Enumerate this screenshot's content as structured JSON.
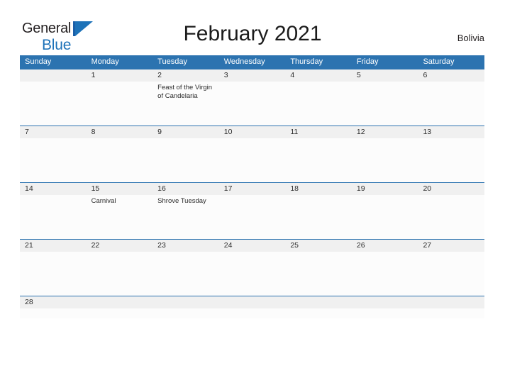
{
  "brand": {
    "word1": "General",
    "word2": "Blue",
    "mark": "triangle-logo"
  },
  "header": {
    "title": "February 2021",
    "region": "Bolivia"
  },
  "calendar": {
    "weekday_headers": [
      "Sunday",
      "Monday",
      "Tuesday",
      "Wednesday",
      "Thursday",
      "Friday",
      "Saturday"
    ],
    "colors": {
      "header_blue": "#2c73b0",
      "band_gray": "#f0f0f0",
      "divider_blue": "#2c73b0",
      "text_dark": "#2b2b2b",
      "brand_blue": "#1d72b8"
    },
    "weeks": [
      {
        "days": [
          {
            "number": "",
            "event": ""
          },
          {
            "number": "1",
            "event": ""
          },
          {
            "number": "2",
            "event": "Feast of the Virgin\nof Candelaria"
          },
          {
            "number": "3",
            "event": ""
          },
          {
            "number": "4",
            "event": ""
          },
          {
            "number": "5",
            "event": ""
          },
          {
            "number": "6",
            "event": ""
          }
        ]
      },
      {
        "days": [
          {
            "number": "7",
            "event": ""
          },
          {
            "number": "8",
            "event": ""
          },
          {
            "number": "9",
            "event": ""
          },
          {
            "number": "10",
            "event": ""
          },
          {
            "number": "11",
            "event": ""
          },
          {
            "number": "12",
            "event": ""
          },
          {
            "number": "13",
            "event": ""
          }
        ]
      },
      {
        "days": [
          {
            "number": "14",
            "event": ""
          },
          {
            "number": "15",
            "event": "Carnival"
          },
          {
            "number": "16",
            "event": "Shrove Tuesday"
          },
          {
            "number": "17",
            "event": ""
          },
          {
            "number": "18",
            "event": ""
          },
          {
            "number": "19",
            "event": ""
          },
          {
            "number": "20",
            "event": ""
          }
        ]
      },
      {
        "days": [
          {
            "number": "21",
            "event": ""
          },
          {
            "number": "22",
            "event": ""
          },
          {
            "number": "23",
            "event": ""
          },
          {
            "number": "24",
            "event": ""
          },
          {
            "number": "25",
            "event": ""
          },
          {
            "number": "26",
            "event": ""
          },
          {
            "number": "27",
            "event": ""
          }
        ]
      },
      {
        "days": [
          {
            "number": "28",
            "event": ""
          },
          {
            "number": "",
            "event": ""
          },
          {
            "number": "",
            "event": ""
          },
          {
            "number": "",
            "event": ""
          },
          {
            "number": "",
            "event": ""
          },
          {
            "number": "",
            "event": ""
          },
          {
            "number": "",
            "event": ""
          }
        ]
      }
    ]
  }
}
